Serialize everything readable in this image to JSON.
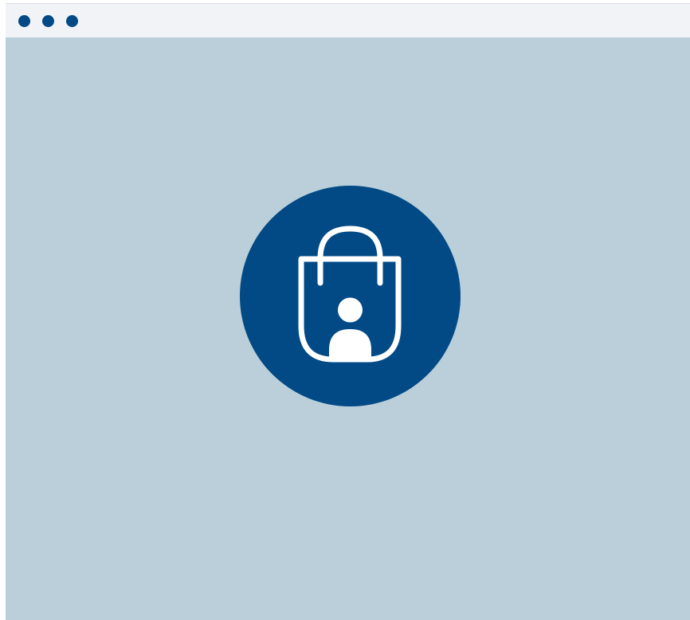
{
  "window": {
    "controls": [
      {
        "name": "window-control-1",
        "color": "#024a86"
      },
      {
        "name": "window-control-2",
        "color": "#024a86"
      },
      {
        "name": "window-control-3",
        "color": "#024a86"
      }
    ]
  },
  "main": {
    "background_color": "#bacfd9",
    "logo": {
      "icon": "shopping-bag-person-icon",
      "circle_color": "#024a86",
      "icon_color": "#ffffff"
    }
  }
}
